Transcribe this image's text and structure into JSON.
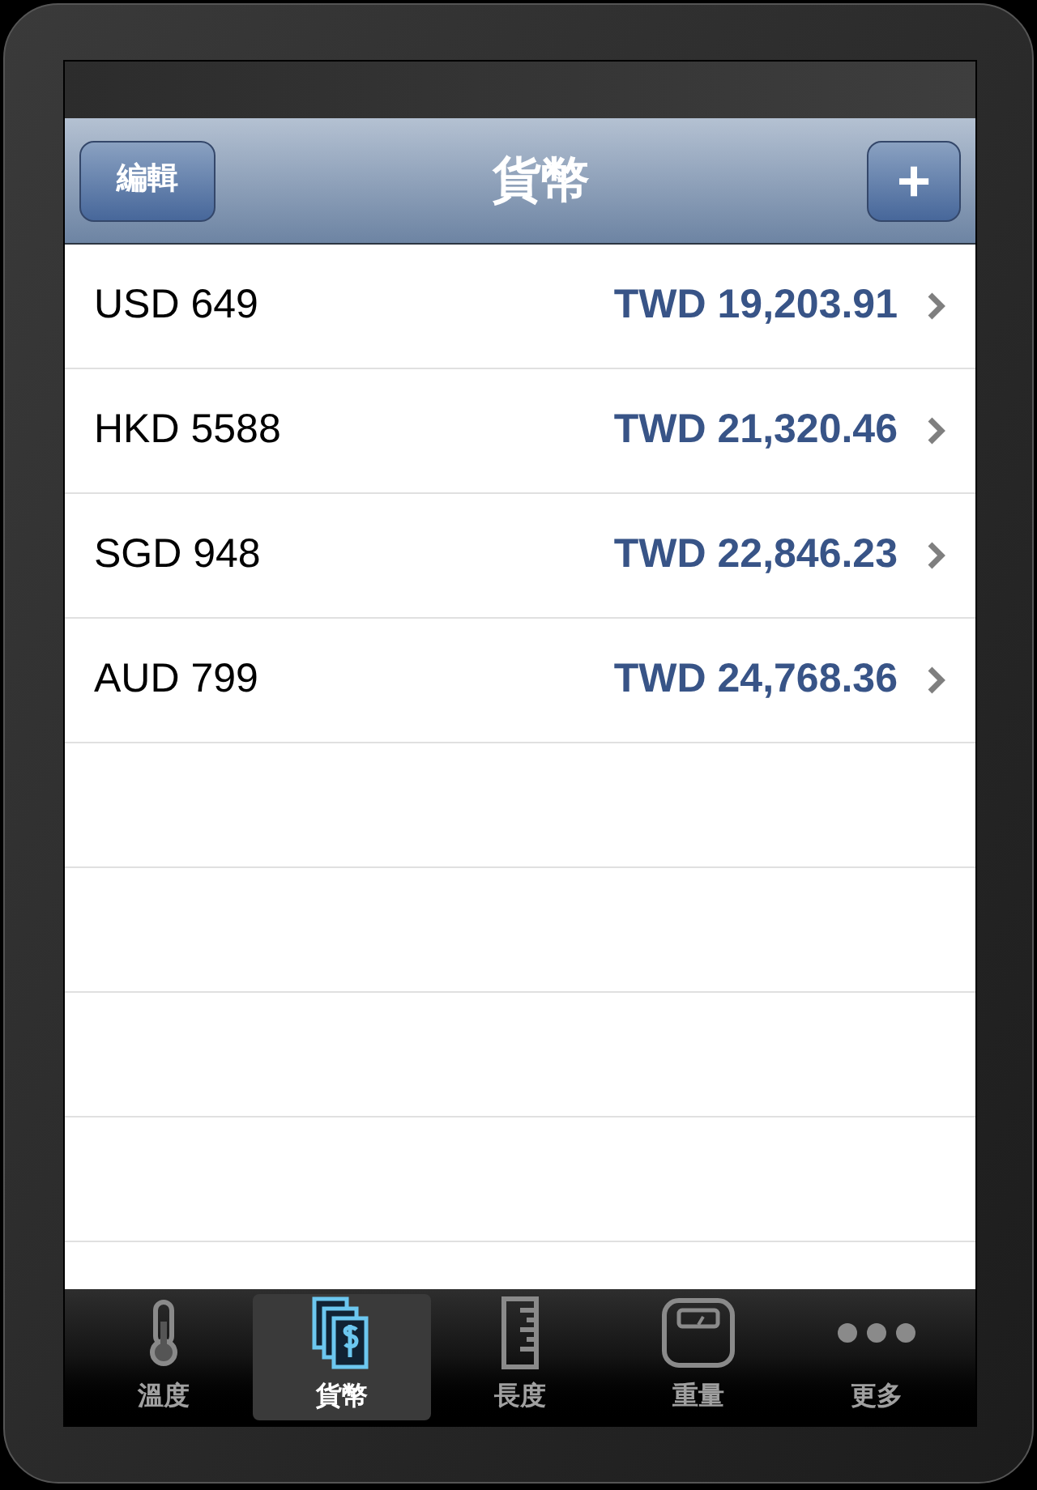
{
  "nav_bar": {
    "edit_button": "編輯",
    "title": "貨幣",
    "add_button": "+"
  },
  "rows": [
    {
      "from": "USD 649",
      "to": "TWD 19,203.91"
    },
    {
      "from": "HKD 5588",
      "to": "TWD 21,320.46"
    },
    {
      "from": "SGD 948",
      "to": "TWD 22,846.23"
    },
    {
      "from": "AUD 799",
      "to": "TWD 24,768.36"
    }
  ],
  "tab_bar": [
    {
      "kind": "thermometer",
      "label": "溫度",
      "selected": false
    },
    {
      "kind": "currency",
      "label": "貨幣",
      "selected": true
    },
    {
      "kind": "ruler",
      "label": "長度",
      "selected": false
    },
    {
      "kind": "scale",
      "label": "重量",
      "selected": false
    },
    {
      "kind": "more",
      "label": "更多",
      "selected": false
    }
  ]
}
